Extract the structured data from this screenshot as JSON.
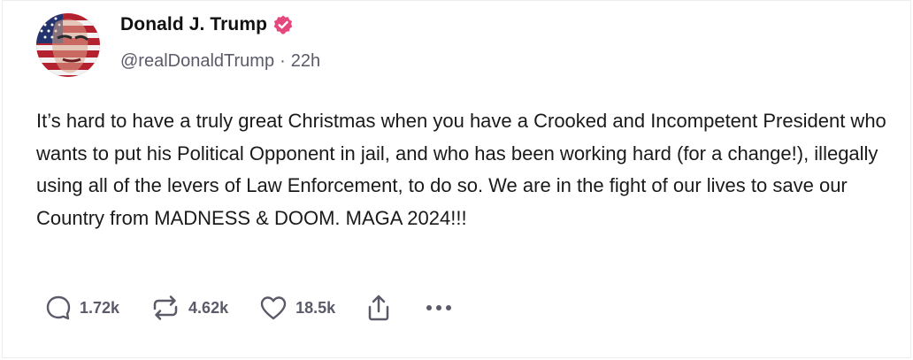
{
  "post": {
    "author_name": "Donald J. Trump",
    "handle": "@realDonaldTrump",
    "separator": "·",
    "time": "22h",
    "text": "It’s hard to have a truly great Christmas when you have a Crooked and Incompetent President who wants to put his Political Opponent in jail, and who has been working hard (for a change!), illegally using all of the levers of Law Enforcement, to do so. We are in the fight of our lives to save our Country from MADNESS & DOOM. MAGA 2024!!!"
  },
  "actions": {
    "replies": "1.72k",
    "reposts": "4.62k",
    "likes": "18.5k"
  },
  "icons": {
    "verified": "verified-badge-icon",
    "reply": "reply-bubble-icon",
    "repost": "repost-arrows-icon",
    "like": "heart-icon",
    "share": "share-upload-icon",
    "more": "more-dots-icon"
  },
  "colors": {
    "verified_badge": "#e5487c",
    "action_gray": "#5a5a69",
    "text": "#1a1a1a"
  }
}
